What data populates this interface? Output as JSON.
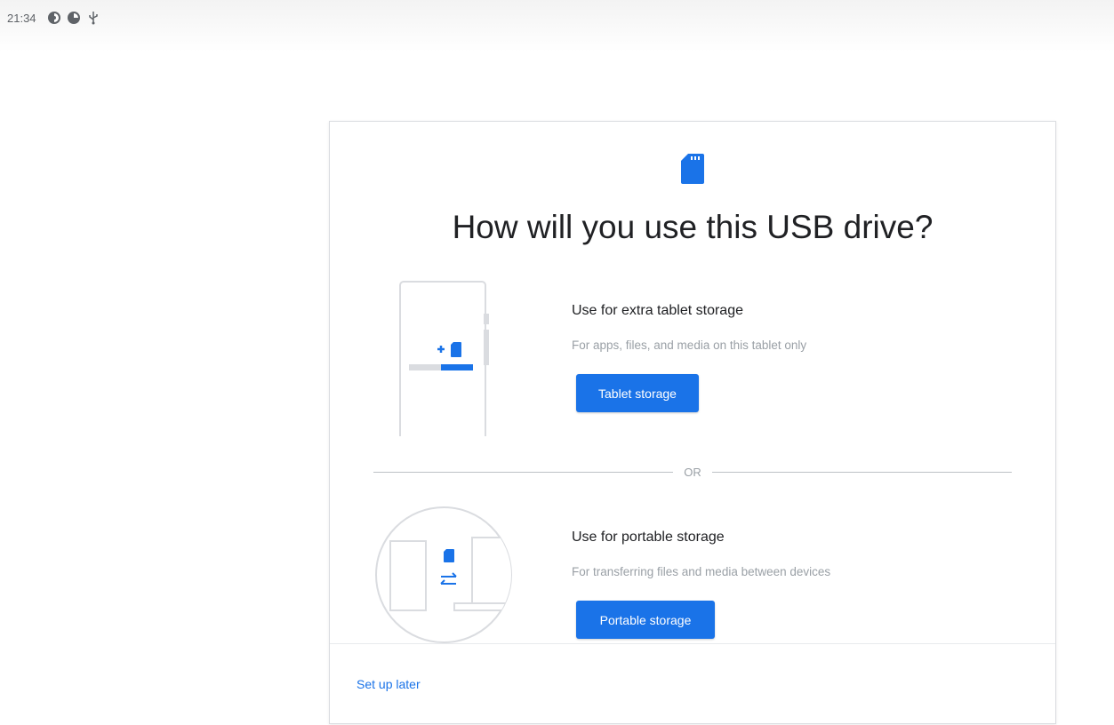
{
  "status_bar": {
    "time": "21:34",
    "icons": [
      "notification-icon",
      "notification-icon",
      "usb-icon"
    ]
  },
  "dialog": {
    "icon": "sd-card-icon",
    "title": "How will you use this USB drive?",
    "options": [
      {
        "title": "Use for extra tablet storage",
        "description": "For apps, files, and media on this tablet only",
        "button_label": "Tablet storage",
        "illustration": "tablet-storage-illustration"
      },
      {
        "title": "Use for portable storage",
        "description": "For transferring files and media between devices",
        "button_label": "Portable storage",
        "illustration": "portable-storage-illustration"
      }
    ],
    "divider_text": "OR",
    "footer_link": "Set up later"
  },
  "colors": {
    "accent": "#1a73e8",
    "text_primary": "#202124",
    "text_secondary": "#9aa0a6",
    "divider": "#bdc1c6"
  }
}
